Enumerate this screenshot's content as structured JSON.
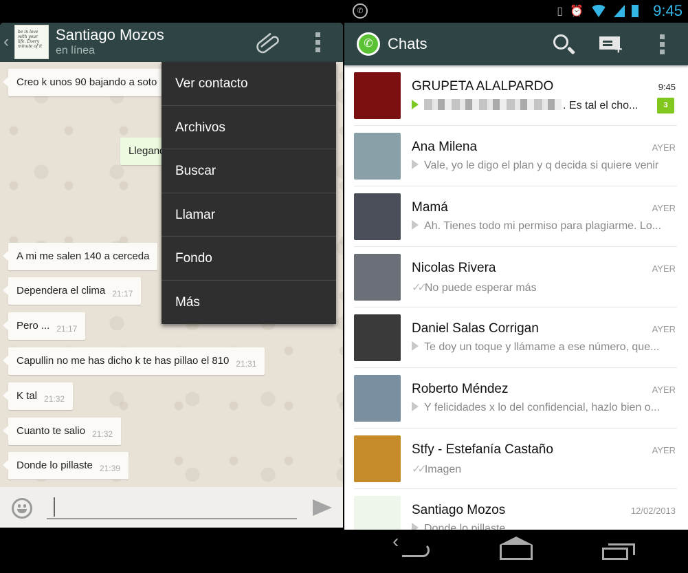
{
  "conversation": {
    "contact_name": "Santiago Mozos",
    "contact_status": "en línea",
    "avatar_text": "be in love with your life. Every minute of it",
    "messages": [
      {
        "text": "Creo k unos 90 bajando a soto",
        "time": "",
        "direction": "in"
      },
      {
        "text": "Llegando",
        "time": "",
        "direction": "out"
      },
      {
        "text": "A mi me salen 140 a cerceda",
        "time": "",
        "direction": "in"
      },
      {
        "text": "Dependera el clima",
        "time": "21:17",
        "direction": "in"
      },
      {
        "text": "Pero ...",
        "time": "21:17",
        "direction": "in"
      },
      {
        "text": "Capullin no me has dicho k te has pillao el 810",
        "time": "21:31",
        "direction": "in"
      },
      {
        "text": "K tal",
        "time": "21:32",
        "direction": "in"
      },
      {
        "text": "Cuanto te salio",
        "time": "21:32",
        "direction": "in"
      },
      {
        "text": "Donde lo pillaste",
        "time": "21:39",
        "direction": "in"
      }
    ],
    "overflow_menu": [
      "Ver contacto",
      "Archivos",
      "Buscar",
      "Llamar",
      "Fondo",
      "Más"
    ],
    "input_value": ""
  },
  "status_bar": {
    "time": "9:45",
    "accent": "#33b5e5"
  },
  "chats_screen": {
    "title": "Chats",
    "header_color": "#2f4545",
    "chats": [
      {
        "name": "GRUPETA ALALPARDO",
        "time": "9:45",
        "preview": ". Es tal el cho...",
        "status": "unread",
        "unread_count": "3",
        "avatar_color": "#7a1010"
      },
      {
        "name": "Ana Milena",
        "time": "AYER",
        "preview": "Vale, yo le digo el plan y q decida si quiere venir",
        "status": "received",
        "avatar_color": "#8aa0a8"
      },
      {
        "name": "Mamá",
        "time": "AYER",
        "preview": "Ah. Tienes todo mi permiso para plagiarme. Lo...",
        "status": "received",
        "avatar_color": "#4a4f5a"
      },
      {
        "name": "Nicolas Rivera",
        "time": "AYER",
        "preview": "No puede esperar más",
        "status": "read",
        "avatar_color": "#6a6f78"
      },
      {
        "name": "Daniel Salas Corrigan",
        "time": "AYER",
        "preview": "Te doy un toque y llámame a ese número, que...",
        "status": "received",
        "avatar_color": "#3a3a3a"
      },
      {
        "name": "Roberto Méndez",
        "time": "AYER",
        "preview": "Y felicidades x lo del confidencial, hazlo bien o...",
        "status": "received",
        "avatar_color": "#7a8fa0"
      },
      {
        "name": "Stfy - Estefanía Castaño",
        "time": "AYER",
        "preview": "Imagen",
        "status": "read",
        "avatar_color": "#c58a2a"
      },
      {
        "name": "Santiago Mozos",
        "time": "12/02/2013",
        "preview": "Donde lo pillaste",
        "status": "received",
        "avatar_color": "#eef5ea"
      }
    ],
    "unread_badge_color": "#82c71e"
  }
}
